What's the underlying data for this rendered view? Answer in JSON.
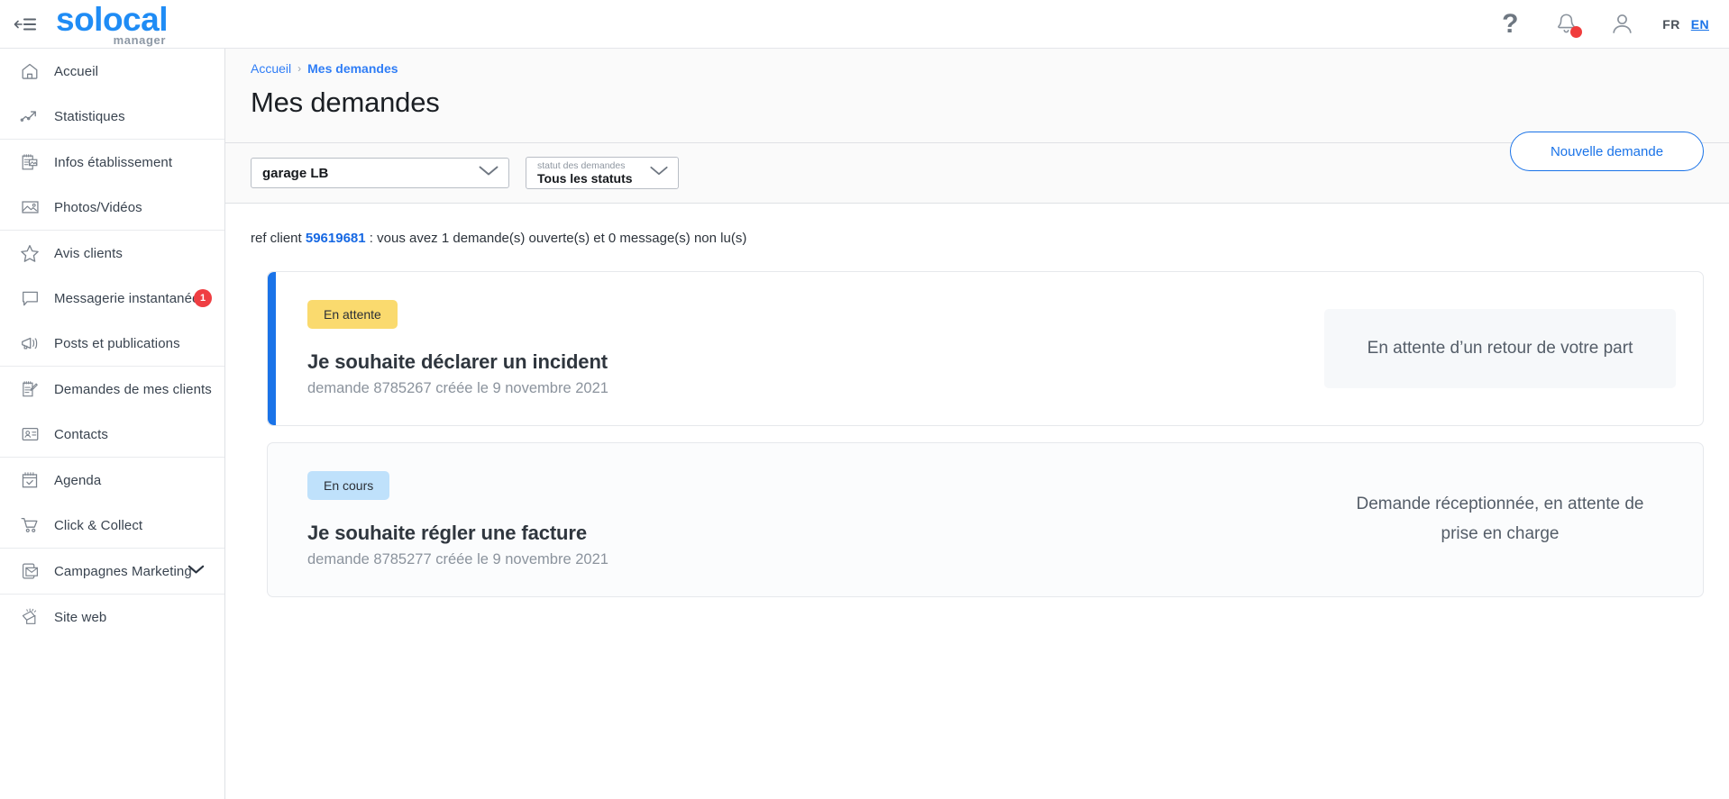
{
  "topbar": {
    "collapse_icon": "collapse-sidebar-icon",
    "brand_main": "solocal",
    "brand_sub": "manager",
    "help_icon": "question-mark-icon",
    "notifications_icon": "bell-icon",
    "notification_dot": true,
    "account_icon": "user-avatar-icon",
    "lang_fr": "FR",
    "lang_en": "EN",
    "lang_active": "EN"
  },
  "sidebar": {
    "groups": [
      {
        "items": [
          {
            "label": "Accueil",
            "icon": "home-icon"
          },
          {
            "label": "Statistiques",
            "icon": "trend-line-icon"
          }
        ]
      },
      {
        "items": [
          {
            "label": "Infos établissement",
            "icon": "business-info-icon"
          },
          {
            "label": "Photos/Vidéos",
            "icon": "image-icon"
          }
        ]
      },
      {
        "items": [
          {
            "label": "Avis clients",
            "icon": "star-icon"
          },
          {
            "label": "Messagerie instantanée",
            "icon": "chat-bubble-icon",
            "badge": "1"
          },
          {
            "label": "Posts et publications",
            "icon": "megaphone-icon"
          }
        ]
      },
      {
        "items": [
          {
            "label": "Demandes de mes clients",
            "icon": "clipboard-edit-icon"
          },
          {
            "label": "Contacts",
            "icon": "contact-card-icon"
          }
        ]
      },
      {
        "items": [
          {
            "label": "Agenda",
            "icon": "calendar-check-icon"
          },
          {
            "label": "Click & Collect",
            "icon": "shopping-cart-icon"
          }
        ]
      },
      {
        "items": [
          {
            "label": "Campagnes Marketing",
            "icon": "envelope-mobile-icon",
            "chevron": "chevron-down-icon"
          }
        ]
      },
      {
        "items": [
          {
            "label": "Site web",
            "icon": "website-icon"
          }
        ]
      }
    ]
  },
  "main": {
    "breadcrumb": {
      "home": "Accueil",
      "separator": "›",
      "current": "Mes demandes"
    },
    "page_title": "Mes demandes",
    "new_request_button": "Nouvelle demande",
    "filters": {
      "establishment_value": "garage LB",
      "status_label": "statut des demandes",
      "status_value": "Tous les statuts",
      "chevron_icon": "chevron-down-icon"
    },
    "ref_line": {
      "prefix": "ref client",
      "ref_number": "59619681",
      "suffix": ": vous avez 1 demande(s) ouverte(s) et 0 message(s) non lu(s)"
    },
    "requests": [
      {
        "status_chip": "En attente",
        "chip_style": "waiting",
        "title": "Je souhaite déclarer un incident",
        "meta": "demande 8785267 créée le 9 novembre 2021",
        "status_text": "En attente d’un retour de votre part",
        "accent": true,
        "shaded_status": true
      },
      {
        "status_chip": "En cours",
        "chip_style": "progress",
        "title": "Je souhaite régler une facture",
        "meta": "demande 8785277 créée le 9 novembre 2021",
        "status_text": "Demande réceptionnée, en attente de prise en charge",
        "accent": false,
        "shaded_status": false
      }
    ]
  },
  "colors": {
    "brand_blue": "#1f8cf5",
    "link_blue": "#1a73e8",
    "accent_bar": "#1a73e8",
    "chip_waiting": "#fada6e",
    "chip_progress": "#bfe1fb",
    "badge_red": "#ef3e42"
  }
}
